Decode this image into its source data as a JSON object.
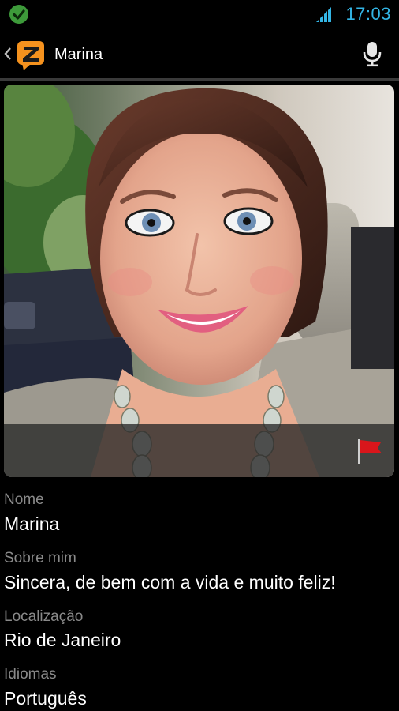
{
  "status_bar": {
    "time": "17:03",
    "accent_color": "#33b5e5",
    "icons": [
      "check-icon",
      "signal-icon"
    ]
  },
  "action_bar": {
    "title": "Marina",
    "logo_icon": "zoosk-z-logo",
    "mic_icon": "microphone-icon",
    "back_icon": "back-caret-icon"
  },
  "photo": {
    "flag_icon": "report-flag-icon"
  },
  "profile": {
    "fields": [
      {
        "label": "Nome",
        "value": "Marina"
      },
      {
        "label": "Sobre mim",
        "value": "Sincera, de bem com a vida e muito feliz!"
      },
      {
        "label": "Localização",
        "value": "Rio de Janeiro"
      },
      {
        "label": "Idiomas",
        "value": "Português"
      }
    ]
  },
  "colors": {
    "background": "#000000",
    "label": "#8a8a8a",
    "logo_orange": "#f5921e",
    "flag_red": "#d9161b"
  }
}
